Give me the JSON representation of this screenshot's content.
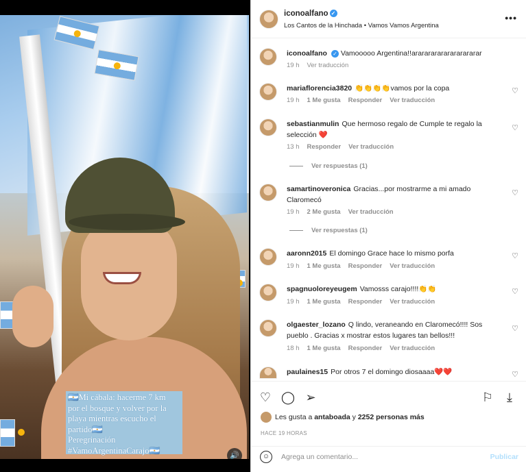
{
  "post": {
    "username": "iconoalfano",
    "subtitle": "Los Cantos de la Hinchada • Vamos Vamos Argentina",
    "more_icon": "ellipsis-icon"
  },
  "media": {
    "caption_lines": [
      "🇦🇷Mi cábala: hacerme 7 km",
      "por el bosque y volver por la",
      "playa mientras escucho el",
      "partido🇦🇷",
      "Peregrinación",
      "#VamoArgentinaCarajo🇦🇷"
    ],
    "audio_icon": "speaker-icon"
  },
  "caption": {
    "username": "iconoalfano",
    "text": "Vamooooo Argentina!!ararararararararararar",
    "time": "19 h",
    "translate": "Ver traducción"
  },
  "comments": [
    {
      "username": "mariaflorencia3820",
      "text": "👏👏👏👏vamos por la copa",
      "time": "19 h",
      "likes": "1 Me gusta",
      "reply": "Responder",
      "translate": "Ver traducción"
    },
    {
      "username": "sebastianmulin",
      "text": "Que hermoso regalo de Cumple te regalo la selección ❤️",
      "time": "13 h",
      "reply": "Responder",
      "translate": "Ver traducción",
      "view_replies": "Ver respuestas (1)"
    },
    {
      "username": "samartinoveronica",
      "text": "Gracias...por mostrarme a mi amado Claromecó",
      "time": "19 h",
      "likes": "2 Me gusta",
      "translate": "Ver traducción",
      "view_replies": "Ver respuestas (1)"
    },
    {
      "username": "aaronn2015",
      "text": "El domingo Grace hace lo mismo porfa",
      "time": "19 h",
      "likes": "1 Me gusta",
      "reply": "Responder",
      "translate": "Ver traducción"
    },
    {
      "username": "spagnuoloreyeugem",
      "text": "Vamosss carajo!!!!👏👏",
      "time": "19 h",
      "likes": "1 Me gusta",
      "reply": "Responder",
      "translate": "Ver traducción"
    },
    {
      "username": "olgaester_lozano",
      "text": "Q lindo, veraneando en Claromecó!!!! Sos pueblo . Gracias x mostrar estos lugares tan bellos!!!",
      "time": "18 h",
      "likes": "1 Me gusta",
      "reply": "Responder",
      "translate": "Ver traducción"
    },
    {
      "username": "paulaines15",
      "text": "Por otros 7 el domingo diosaaaa❤️❤️"
    }
  ],
  "actions": {
    "like_icon": "heart-icon",
    "comment_icon": "comment-icon",
    "share_icon": "send-icon",
    "save_icon": "bookmark-icon",
    "download_icon": "download-icon",
    "likes_prefix": "Les gusta a",
    "likes_user": "antaboada",
    "likes_joiner": "y",
    "likes_count": "2252 personas más",
    "posted_ago": "HACE 19 HORAS"
  },
  "compose": {
    "placeholder": "Agrega un comentario...",
    "publish": "Publicar"
  }
}
